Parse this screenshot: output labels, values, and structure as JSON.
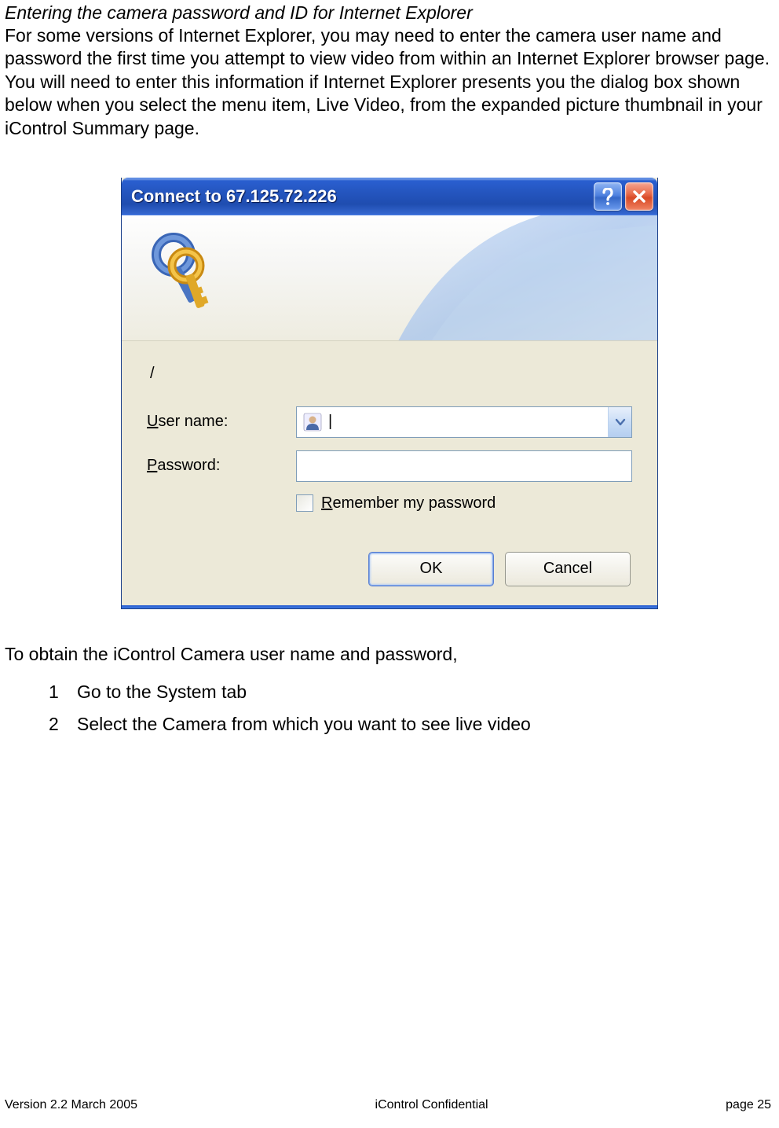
{
  "doc": {
    "heading": "Entering the camera password and ID for Internet Explorer",
    "paragraph": "For some versions of Internet Explorer, you may need to enter the camera user name and password the first time you attempt to view video from within an Internet Explorer browser page. You will need to enter this information if Internet Explorer presents you the dialog box shown below when you select the menu item, Live Video, from the expanded picture thumbnail in your iControl Summary page.",
    "obtain_text": "To obtain the iControl Camera user name and password,",
    "steps": [
      {
        "num": "1",
        "text": "Go to the System tab"
      },
      {
        "num": "2",
        "text": "Select the Camera from which you want to see live video"
      }
    ]
  },
  "dialog": {
    "title": "Connect to 67.125.72.226",
    "realm": "/",
    "username_label_pre": "U",
    "username_label_post": "ser name:",
    "password_label_pre": "P",
    "password_label_post": "assword:",
    "username_value": "|",
    "password_value": "",
    "remember_pre": "R",
    "remember_post": "emember my password",
    "ok_label": "OK",
    "cancel_label": "Cancel"
  },
  "footer": {
    "left": "Version 2.2 March 2005",
    "center": "iControl      Confidential",
    "right": "page 25"
  }
}
